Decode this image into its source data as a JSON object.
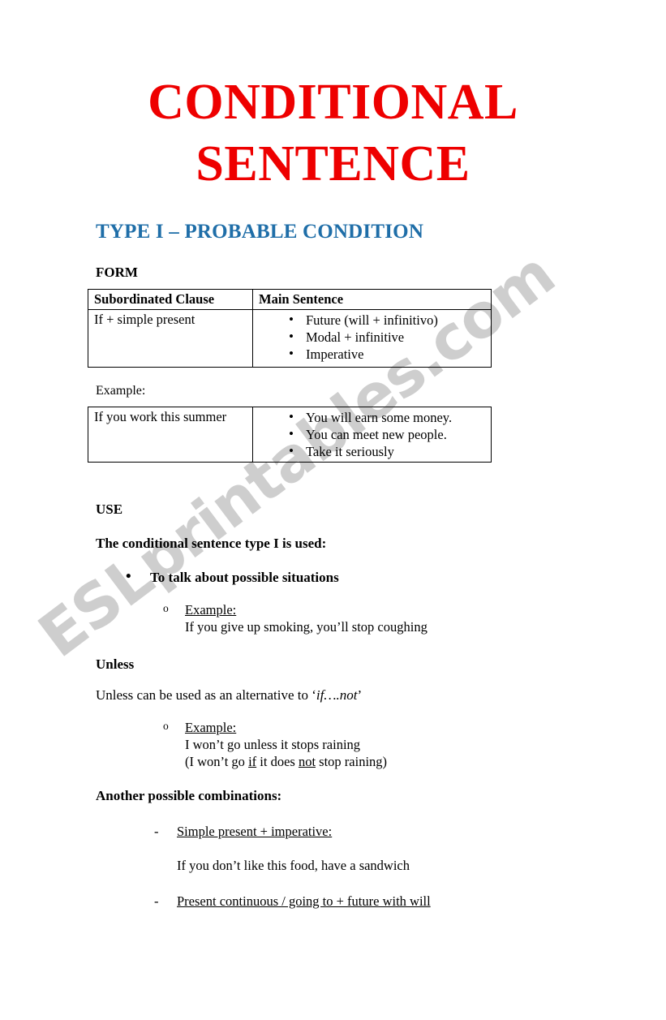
{
  "document": {
    "title_lines": [
      "CONDITIONAL",
      "SENTENCE"
    ],
    "title_color": "#ee0000",
    "subtitle": "TYPE I – PROBABLE CONDITION",
    "subtitle_color": "#1f6ea8"
  },
  "watermark": {
    "text": "ESLprintables.com",
    "color": "#cecece"
  },
  "form_section": {
    "heading": "FORM",
    "table": {
      "headers": [
        "Subordinated Clause",
        "Main Sentence"
      ],
      "row": {
        "left": "If + simple present",
        "right_bullets": [
          "Future (will + infinitivo)",
          "Modal + infinitive",
          "Imperative"
        ]
      }
    },
    "example_label": "Example:",
    "example_table": {
      "row": {
        "left": "If you work this summer",
        "right_bullets": [
          "You will earn some money.",
          "You can meet new people.",
          "Take it seriously"
        ]
      }
    }
  },
  "use_section": {
    "heading": "USE",
    "lead": "The conditional sentence type I is used:",
    "bullet": "To talk about possible situations",
    "example": {
      "label": "Example:",
      "sentence": "If you give up smoking, you’ll stop coughing"
    }
  },
  "unless_section": {
    "heading": "Unless",
    "description_before": "Unless can be used as an alternative to ‘",
    "description_italic": "if….not",
    "description_after": "’",
    "example": {
      "label": "Example:",
      "line1": "I won’t go unless it stops raining",
      "line2_part1": "(I won’t go ",
      "line2_underline1": "if",
      "line2_part2": " it does ",
      "line2_underline2": "not",
      "line2_part3": " stop raining)"
    }
  },
  "combinations_section": {
    "heading": "Another possible combinations:",
    "items": [
      {
        "label": "Simple present + imperative:",
        "example": "If you don’t like this food, have a sandwich"
      },
      {
        "label": "Present continuous / going to + future with will",
        "example": ""
      }
    ]
  }
}
